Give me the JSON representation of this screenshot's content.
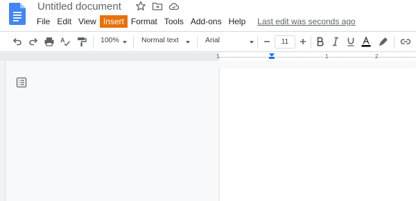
{
  "app": {
    "title": "Untitled document",
    "last_edit": "Last edit was seconds ago"
  },
  "menu": [
    {
      "label": "File"
    },
    {
      "label": "Edit"
    },
    {
      "label": "View"
    },
    {
      "label": "Insert",
      "highlighted": true
    },
    {
      "label": "Format"
    },
    {
      "label": "Tools"
    },
    {
      "label": "Add-ons"
    },
    {
      "label": "Help"
    }
  ],
  "toolbar": {
    "zoom": "100%",
    "style": "Normal text",
    "font": "Arial",
    "font_size": "11",
    "icons": [
      "undo-icon",
      "redo-icon",
      "print-icon",
      "spellcheck-icon",
      "paint-format-icon",
      "decrease-font-size-icon",
      "increase-font-size-icon",
      "bold-icon",
      "italic-icon",
      "underline-icon",
      "text-color-icon",
      "highlight-icon",
      "link-icon"
    ]
  },
  "ruler": {
    "labels": [
      "1",
      "1",
      "2"
    ]
  },
  "colors": {
    "accent": "#1a73e8",
    "menu_highlight": "#e8710a",
    "text_color_bar": "#000000"
  }
}
